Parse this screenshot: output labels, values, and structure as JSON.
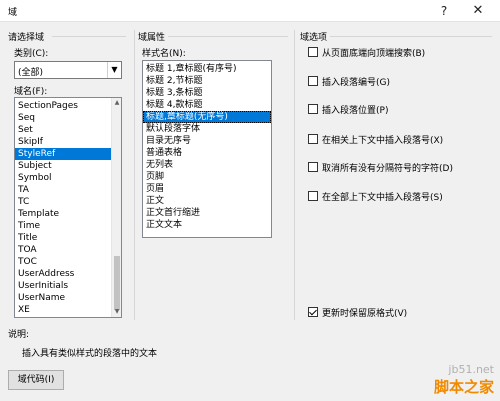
{
  "window": {
    "title": "域",
    "help": "?",
    "close": "✕"
  },
  "choose_field": {
    "heading": "请选择域",
    "category_label": "类别(C):",
    "category_value": "(全部)",
    "fieldname_label": "域名(F):",
    "fields": [
      "SectionPages",
      "Seq",
      "Set",
      "SkipIf",
      "StyleRef",
      "Subject",
      "Symbol",
      "TA",
      "TC",
      "Template",
      "Time",
      "Title",
      "TOA",
      "TOC",
      "UserAddress",
      "UserInitials",
      "UserName",
      "XE"
    ],
    "selected_field": "StyleRef"
  },
  "field_properties": {
    "heading": "域属性",
    "style_label": "样式名(N):",
    "styles": [
      "标题 1,章标题(有序号)",
      "标题 2,节标题",
      "标题 3,条标题",
      "标题 4,款标题",
      "标题,章标题(无序号)",
      "默认段落字体",
      "目录无序号",
      "普通表格",
      "无列表",
      "页脚",
      "页眉",
      "正文",
      "正文首行缩进",
      "正文文本"
    ],
    "selected_style": "标题,章标题(无序号)"
  },
  "field_options": {
    "heading": "域选项",
    "options": [
      {
        "label": "从页面底端向顶端搜索(B)",
        "checked": false
      },
      {
        "label": "插入段落编号(G)",
        "checked": false
      },
      {
        "label": "插入段落位置(P)",
        "checked": false
      },
      {
        "label": "在相关上下文中插入段落号(X)",
        "checked": false
      },
      {
        "label": "取消所有没有分隔符号的字符(D)",
        "checked": false
      },
      {
        "label": "在全部上下文中插入段落号(S)",
        "checked": false
      }
    ],
    "preserve": {
      "label": "更新时保留原格式(V)",
      "checked": true
    }
  },
  "description": {
    "label": "说明:",
    "text": "插入具有类似样式的段落中的文本"
  },
  "buttons": {
    "field_codes": "域代码(I)"
  },
  "watermark": {
    "site": "jb51.net",
    "name": "脚本之家"
  }
}
